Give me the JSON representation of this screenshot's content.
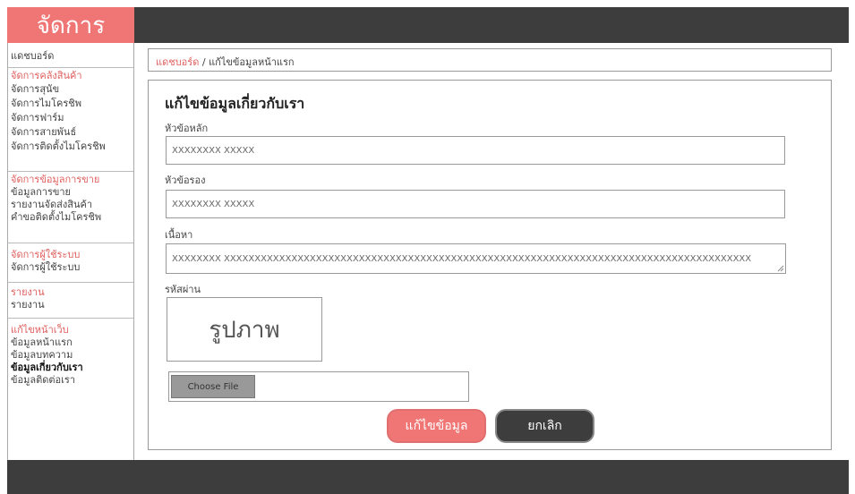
{
  "app": {
    "title": "จัดการ"
  },
  "sidebar": {
    "dashboard": "แดชบอร์ด",
    "groups": [
      {
        "heading": "จัดการคลังสินค้า",
        "items": [
          "จัดการสุนัข",
          "จัดการไมโครชิพ",
          "จัดการฟาร์ม",
          "จัดการสายพันธ์",
          "จัดการติดตั้งไมโครชิพ"
        ]
      },
      {
        "heading": "จัดการข้อมูลการขาย",
        "items": [
          "ข้อมูลการขาย",
          "รายงานจัดส่งสินค้า",
          "คำขอติดตั้งไมโครชิพ"
        ]
      },
      {
        "heading": "จัดการผู้ใช้ระบบ",
        "items": [
          "จัดการผู้ใช้ระบบ"
        ]
      },
      {
        "heading": "รายงาน",
        "items": [
          "รายงาน"
        ]
      },
      {
        "heading": "แก้ไขหน้าเว็บ",
        "items": [
          "ข้อมูลหน้าแรก",
          "ข้อมูลบทความ",
          "ข้อมูลเกี่ยวกับเรา",
          "ข้อมูลติดต่อเรา"
        ]
      }
    ]
  },
  "breadcrumb": {
    "home": "แดชบอร์ด",
    "separator": "/",
    "current": "แก้ไขข้อมูลหน้าแรก"
  },
  "form": {
    "title": "แก้ไขข้อมูลเกี่ยวกับเรา",
    "main_heading_label": "หัวข้อหลัก",
    "main_heading_value": "XXXXXXXX   XXXXX",
    "sub_heading_label": "หัวข้อรอง",
    "sub_heading_value": "XXXXXXXX   XXXXX",
    "content_label": "เนื้อหา",
    "content_value": "XXXXXXXX   XXXXXXXXXXXXXXXXXXXXXXXXXXXXXXXXXXXXXXXXXXXXXXXXXXXXXXXXXXXXXXXXXXXXXXXXXXXXXXXXXXXXXX",
    "password_label": "รหัสผ่าน",
    "image_placeholder": "รูปภาพ",
    "choose_file": "Choose File",
    "submit": "แก้ไขข้อมูล",
    "cancel": "ยกเลิก"
  },
  "colors": {
    "accent": "#f07575",
    "dark": "#3d3d3d"
  }
}
